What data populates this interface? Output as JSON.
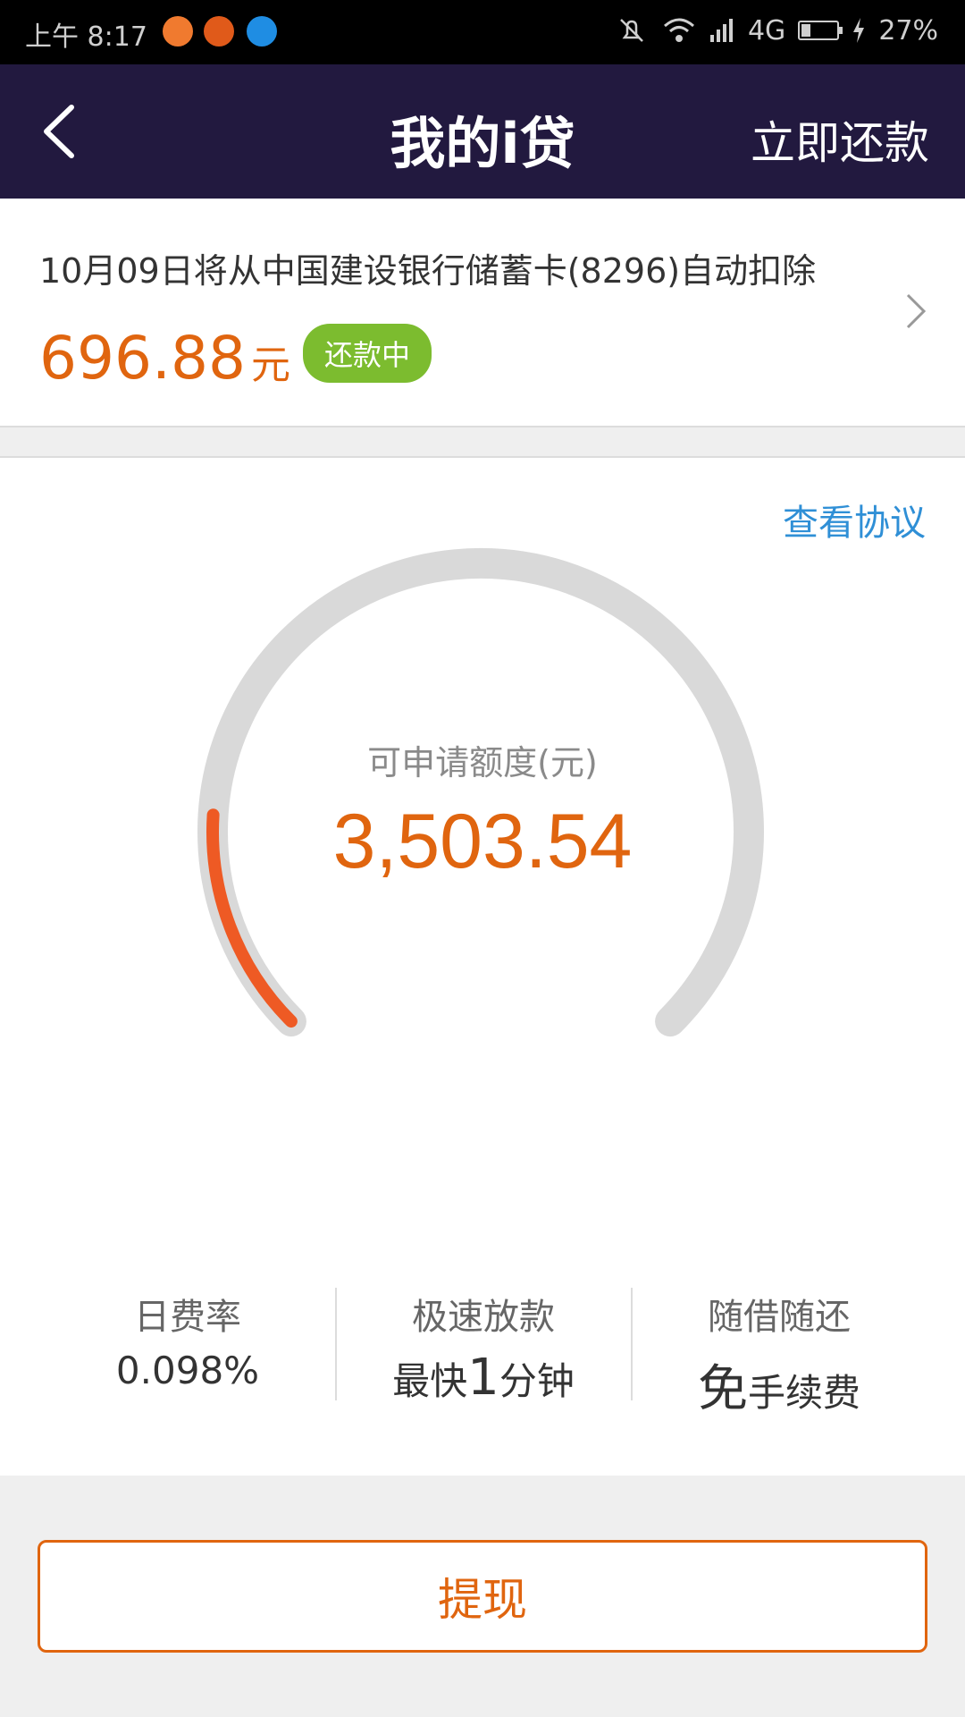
{
  "status_bar": {
    "time": "上午 8:17",
    "network": "4G",
    "battery": "27%",
    "battery_level": 0.27,
    "icons": [
      "chat-bubble-icon",
      "orange-app-icon",
      "blue-app-icon",
      "mute-icon",
      "wifi-icon",
      "signal-icon",
      "battery-icon",
      "charging-icon"
    ]
  },
  "nav": {
    "title": "我的i贷",
    "repay_label": "立即还款",
    "background_color": "#22193f"
  },
  "bill": {
    "description": "10月09日将从中国建设银行储蓄卡(8296)自动扣除",
    "amount": "696.88",
    "unit": "元",
    "status": "还款中",
    "amount_color": "#e0650f",
    "status_color": "#7cbc2f"
  },
  "quota": {
    "agreement_link": "查看协议",
    "label": "可申请额度(元)",
    "value": "3,503.54",
    "gauge_fraction": 0.18,
    "gauge_color": "#ee5a24",
    "track_color": "#d9d9d9"
  },
  "features": [
    {
      "title": "日费率",
      "value": "0.098%"
    },
    {
      "title": "极速放款",
      "value_prefix": "最快",
      "value_big": "1",
      "value_suffix": "分钟"
    },
    {
      "title": "随借随还",
      "value_big": "免",
      "value_suffix": "手续费"
    }
  ],
  "action": {
    "withdraw_label": "提现"
  }
}
